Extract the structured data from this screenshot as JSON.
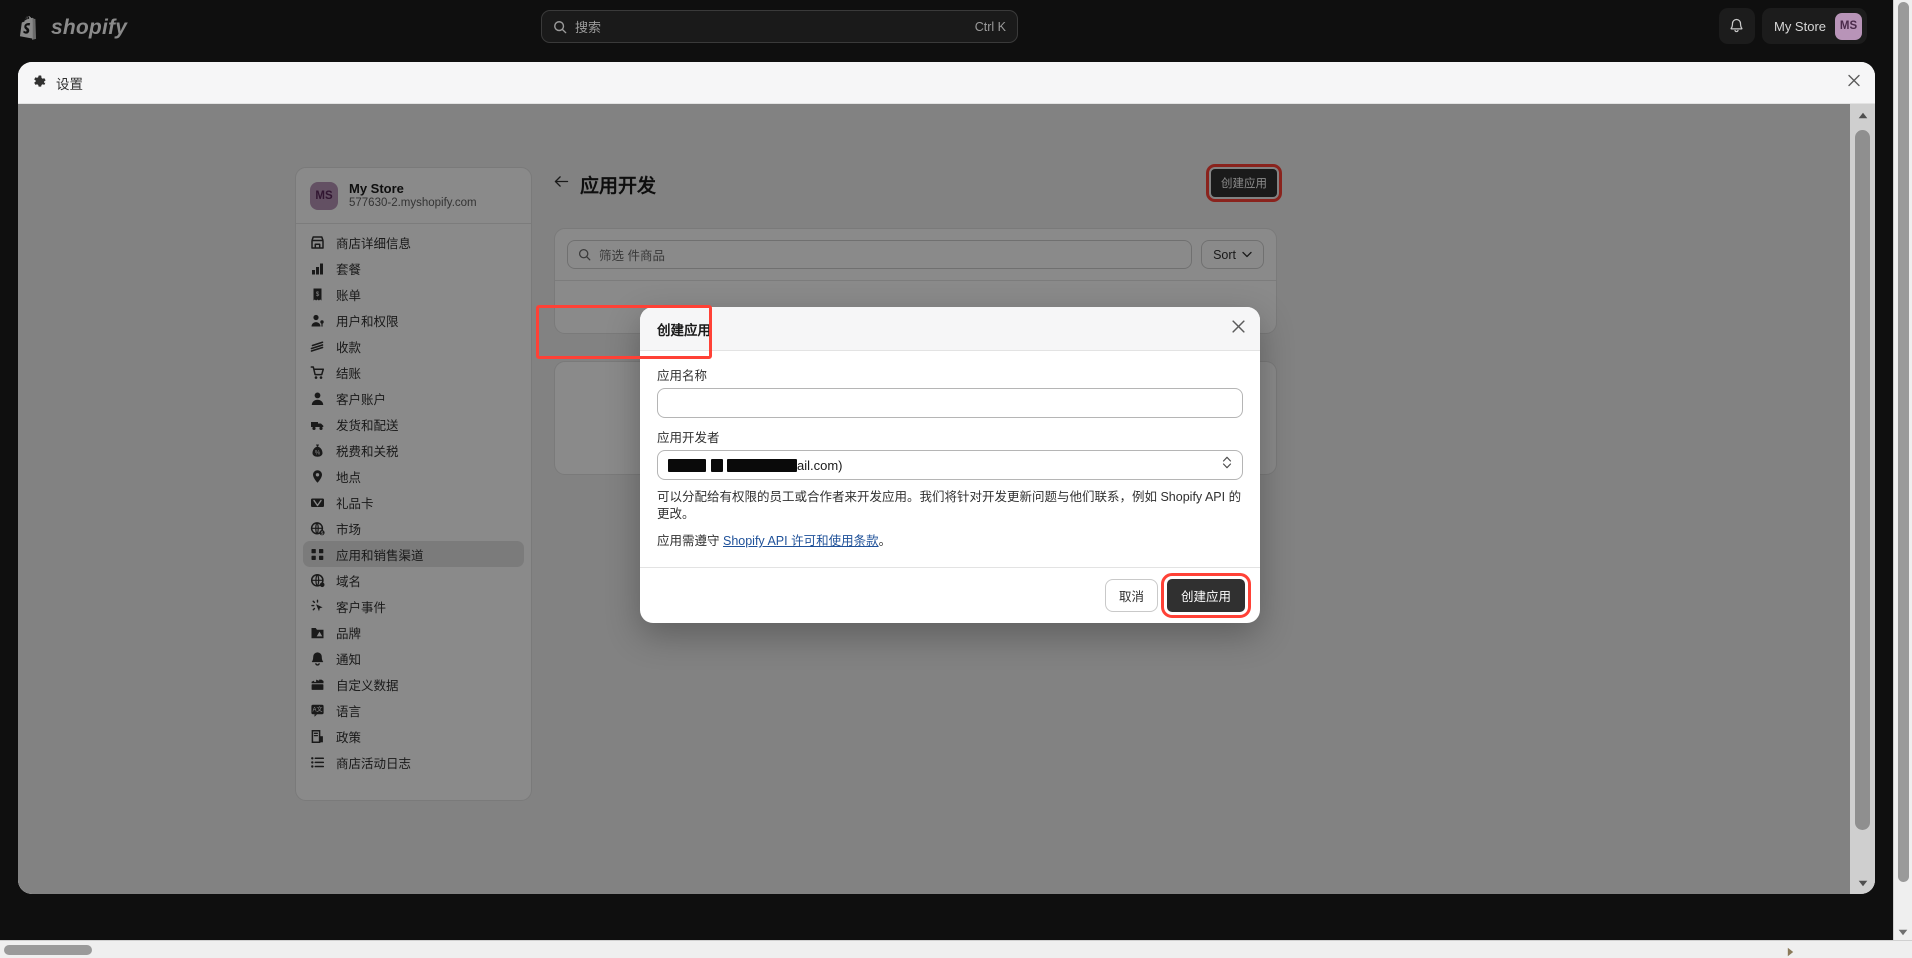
{
  "topbar": {
    "logo_text": "shopify",
    "search_placeholder": "搜索",
    "search_shortcut": "Ctrl K",
    "store_name": "My Store",
    "store_initials": "MS"
  },
  "settings_window": {
    "title": "设置"
  },
  "sidebar": {
    "store_name": "My Store",
    "store_domain": "577630-2.myshopify.com",
    "store_initials": "MS",
    "items": [
      {
        "label": "商店详细信息",
        "icon": "storefront-icon",
        "active": false
      },
      {
        "label": "套餐",
        "icon": "plan-bars-icon",
        "active": false
      },
      {
        "label": "账单",
        "icon": "receipt-icon",
        "active": false
      },
      {
        "label": "用户和权限",
        "icon": "user-key-icon",
        "active": false
      },
      {
        "label": "收款",
        "icon": "payments-card-icon",
        "active": false
      },
      {
        "label": "结账",
        "icon": "cart-icon",
        "active": false
      },
      {
        "label": "客户账户",
        "icon": "person-icon",
        "active": false
      },
      {
        "label": "发货和配送",
        "icon": "delivery-truck-icon",
        "active": false
      },
      {
        "label": "税费和关税",
        "icon": "money-bag-icon",
        "active": false
      },
      {
        "label": "地点",
        "icon": "location-pin-icon",
        "active": false
      },
      {
        "label": "礼品卡",
        "icon": "gift-card-icon",
        "active": false
      },
      {
        "label": "市场",
        "icon": "globe-dollar-icon",
        "active": false
      },
      {
        "label": "应用和销售渠道",
        "icon": "apps-grid-icon",
        "active": true
      },
      {
        "label": "域名",
        "icon": "domain-globe-icon",
        "active": false
      },
      {
        "label": "客户事件",
        "icon": "cursor-click-icon",
        "active": false
      },
      {
        "label": "品牌",
        "icon": "brand-folder-icon",
        "active": false
      },
      {
        "label": "通知",
        "icon": "bell-icon",
        "active": false
      },
      {
        "label": "自定义数据",
        "icon": "database-icon",
        "active": false
      },
      {
        "label": "语言",
        "icon": "translate-icon",
        "active": false
      },
      {
        "label": "政策",
        "icon": "policy-document-icon",
        "active": false
      },
      {
        "label": "商店活动日志",
        "icon": "list-log-icon",
        "active": false
      }
    ]
  },
  "main": {
    "back_label": "←",
    "title": "应用开发",
    "create_app_button": "创建应用",
    "filter_placeholder": "筛选 件商品",
    "sort_button": "Sort"
  },
  "modal": {
    "title": "创建应用",
    "app_name_label": "应用名称",
    "app_name_value": "",
    "developer_label": "应用开发者",
    "developer_value_suffix": "ail.com)",
    "developer_value_redacted": true,
    "help_text_1": "可以分配给有权限的员工或合作者来开发应用。我们将针对开发更新问题与他们联系，例如 Shopify API 的更改。",
    "help_text_2_prefix": "应用需遵守 ",
    "help_link": "Shopify API 许可和使用条款",
    "help_text_2_suffix": "。",
    "cancel_button": "取消",
    "create_button": "创建应用"
  },
  "colors": {
    "highlight_red": "#ff4136",
    "accent_dark": "#303030",
    "avatar_purple": "#b894b8",
    "link_blue": "#1f5199"
  }
}
